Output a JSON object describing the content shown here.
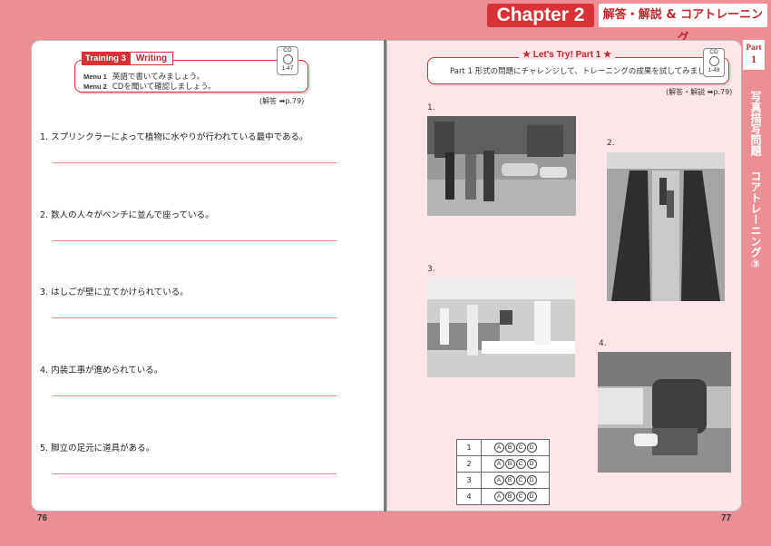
{
  "header": {
    "chapter_label": "Chapter 2",
    "chapter_title": "解答・解説 & コアトレーニング"
  },
  "left_page": {
    "badge_prefix": "Training 3",
    "badge_title": "Writing",
    "menu1_label": "Menu 1",
    "menu1_text": "英語で書いてみましょう。",
    "menu2_label": "Menu 2",
    "menu2_text": "CDを聞いて確認しましょう。",
    "cd_label": "CD",
    "cd_track": "1-47",
    "reference": "(解答 ➡p.79)",
    "questions": [
      "1.  スプリンクラーによって植物に水やりが行われている最中である。",
      "2.  数人の人々がベンチに並んで座っている。",
      "3.  はしごが壁に立てかけられている。",
      "4.  内装工事が進められている。",
      "5.  脚立の足元に道具がある。"
    ],
    "page_number": "76"
  },
  "right_page": {
    "lets_title": "★ Let's Try! Part 1 ★",
    "instruction": "Part 1 形式の問題にチャレンジして、トレーニングの成果を試してみましょう。",
    "cd_label": "CD",
    "cd_track": "1-48",
    "reference": "(解答・解説 ➡p.79)",
    "photo_numbers": [
      "1.",
      "2.",
      "3.",
      "4."
    ],
    "answer_rows": [
      "1",
      "2",
      "3",
      "4"
    ],
    "options": [
      "A",
      "B",
      "C",
      "D"
    ],
    "page_number": "77"
  },
  "side_tab": {
    "part_word": "Part",
    "part_num": "1",
    "section": "写真描写問題",
    "sub": "コアトレーニング③"
  },
  "colors": {
    "background": "#ec8f95",
    "accent_red": "#d83236",
    "right_page_bg": "#fde6e9"
  }
}
